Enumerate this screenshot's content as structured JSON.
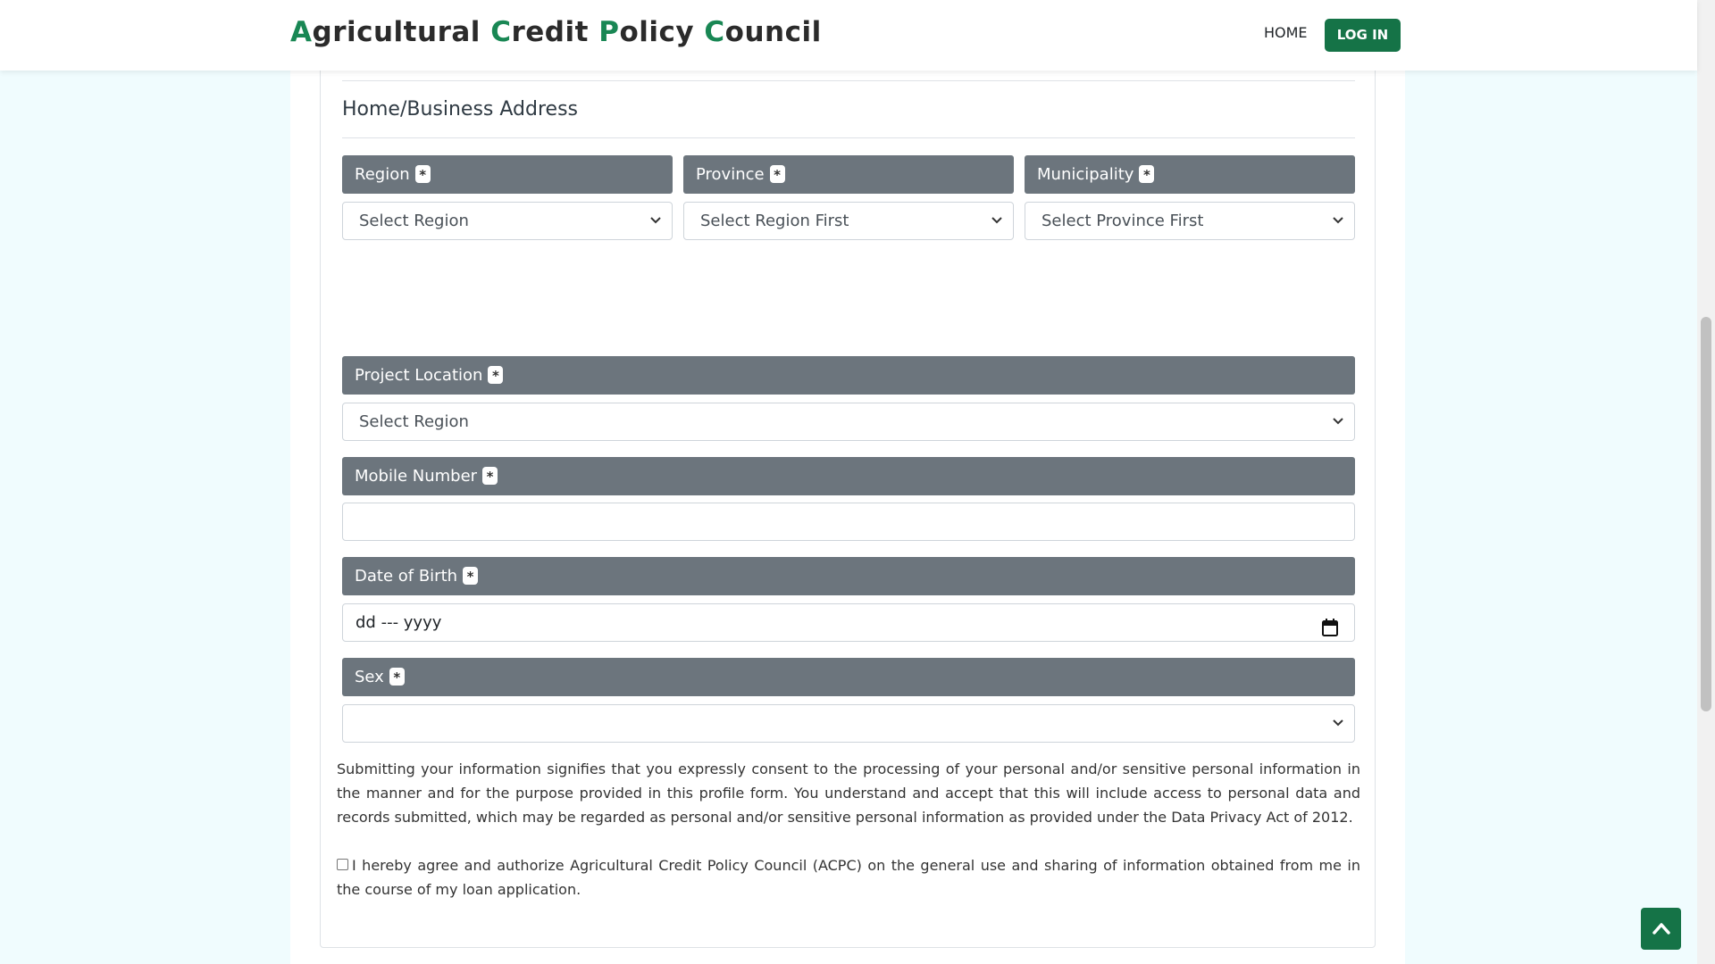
{
  "app": {
    "brand": [
      "A",
      "gricultural ",
      "C",
      "redit ",
      "P",
      "olicy ",
      "C",
      "ouncil"
    ],
    "accent": "#198754",
    "button_color": "#157347",
    "label_bar_color": "#6c757d"
  },
  "nav": {
    "home_label": "HOME",
    "login_label": "LOG IN"
  },
  "form": {
    "section_title": "Home/Business Address",
    "required_marker": "*",
    "region": {
      "label": "Region",
      "value": "Select Region"
    },
    "province": {
      "label": "Province",
      "value": "Select Region First"
    },
    "municipality": {
      "label": "Municipality",
      "value": "Select Province First"
    },
    "project_location": {
      "label": "Project Location",
      "value": "Select Region"
    },
    "mobile_number": {
      "label": "Mobile Number",
      "value": ""
    },
    "date_of_birth": {
      "label": "Date of Birth",
      "value": "dd --- yyyy"
    },
    "sex": {
      "label": "Sex",
      "value": ""
    },
    "consent_text": "Submitting your information signifies that you expressly consent to the processing of your personal and/or sensitive personal information in the manner and for the purpose provided in this profile form. You understand and accept that this will include access to personal data and records submitted, which may be regarded as personal and/or sensitive personal information as provided under the Data Privacy Act of 2012.",
    "agree_text": "I hereby agree and authorize Agricultural Credit Policy Council (ACPC) on the general use and sharing of information obtained from me in the course of my loan application.",
    "agree_checked": false
  },
  "icons": {
    "select_arrow": "chevron-down-icon",
    "date_picker": "calendar-icon",
    "scroll_top": "chevron-up-icon"
  }
}
